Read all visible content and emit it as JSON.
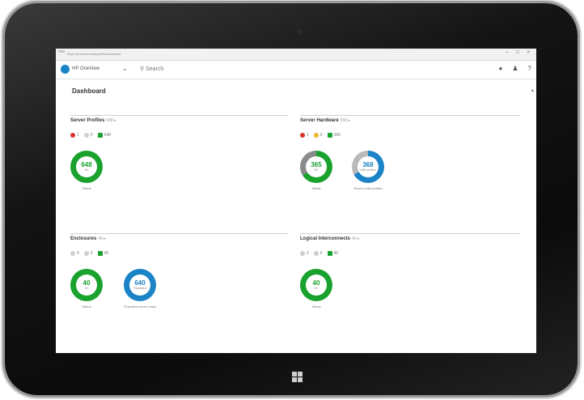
{
  "browser": {
    "url": "https://oneview.example/#/dashboard",
    "window_controls": "– □ ×"
  },
  "header": {
    "app_name": "HP OneView",
    "search_placeholder": "Search",
    "icons": [
      "activity-icon",
      "user-icon",
      "help-icon"
    ],
    "help_glyph": "?"
  },
  "page": {
    "title": "Dashboard"
  },
  "panels": {
    "server_profiles": {
      "title": "Server Profiles",
      "count": "648 ▸",
      "status": {
        "critical": "1",
        "warning": "0",
        "ok": "648"
      },
      "charts": [
        {
          "value": "648",
          "sub": "OK",
          "label": "Status",
          "color": "#1aa22e"
        }
      ]
    },
    "server_hardware": {
      "title": "Server Hardware",
      "count": "550 ▸",
      "status": {
        "critical": "1",
        "warning": "0",
        "ok": "365"
      },
      "charts": [
        {
          "value": "365",
          "sub": "OK",
          "label": "Status",
          "color": "#1aa22e",
          "fraction": 0.66
        },
        {
          "value": "368",
          "sub": "With profiles",
          "label": "Servers with profiles",
          "color": "#1b83c6",
          "fraction": 0.67
        }
      ]
    },
    "enclosures": {
      "title": "Enclosures",
      "count": "40 ▸",
      "status": {
        "critical": "0",
        "warning": "0",
        "ok": "40"
      },
      "charts": [
        {
          "value": "40",
          "sub": "OK",
          "label": "Status",
          "color": "#1aa22e"
        },
        {
          "value": "640",
          "sub": "Populated",
          "label": "Populated device bays",
          "color": "#1b83c6"
        }
      ]
    },
    "logical_interconnects": {
      "title": "Logical Interconnects",
      "count": "40 ▸",
      "status": {
        "critical": "0",
        "warning": "0",
        "ok": "40"
      },
      "charts": [
        {
          "value": "40",
          "sub": "OK",
          "label": "Status",
          "color": "#1aa22e"
        }
      ]
    }
  },
  "colors": {
    "accent": "#1b83c6",
    "ok": "#1aa22e",
    "critical": "#d9342b",
    "warning": "#f0b429",
    "hw_grey": "#8a8a8a"
  }
}
